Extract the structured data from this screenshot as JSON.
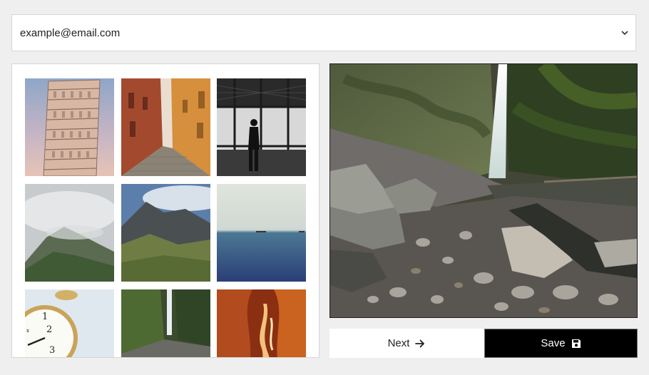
{
  "account_select": {
    "value": "example@email.com"
  },
  "thumbnails": [
    {
      "subject": "leaning-tower"
    },
    {
      "subject": "narrow-street"
    },
    {
      "subject": "station-silhouette"
    },
    {
      "subject": "misty-mountain"
    },
    {
      "subject": "mountain-valley"
    },
    {
      "subject": "calm-sea"
    },
    {
      "subject": "alarm-clock"
    },
    {
      "subject": "waterfall"
    },
    {
      "subject": "canyon"
    }
  ],
  "preview": {
    "subject": "waterfall-rocky-stream"
  },
  "actions": {
    "next_label": "Next",
    "save_label": "Save"
  },
  "colors": {
    "save_bg": "#000000",
    "page_bg": "#efefef"
  }
}
